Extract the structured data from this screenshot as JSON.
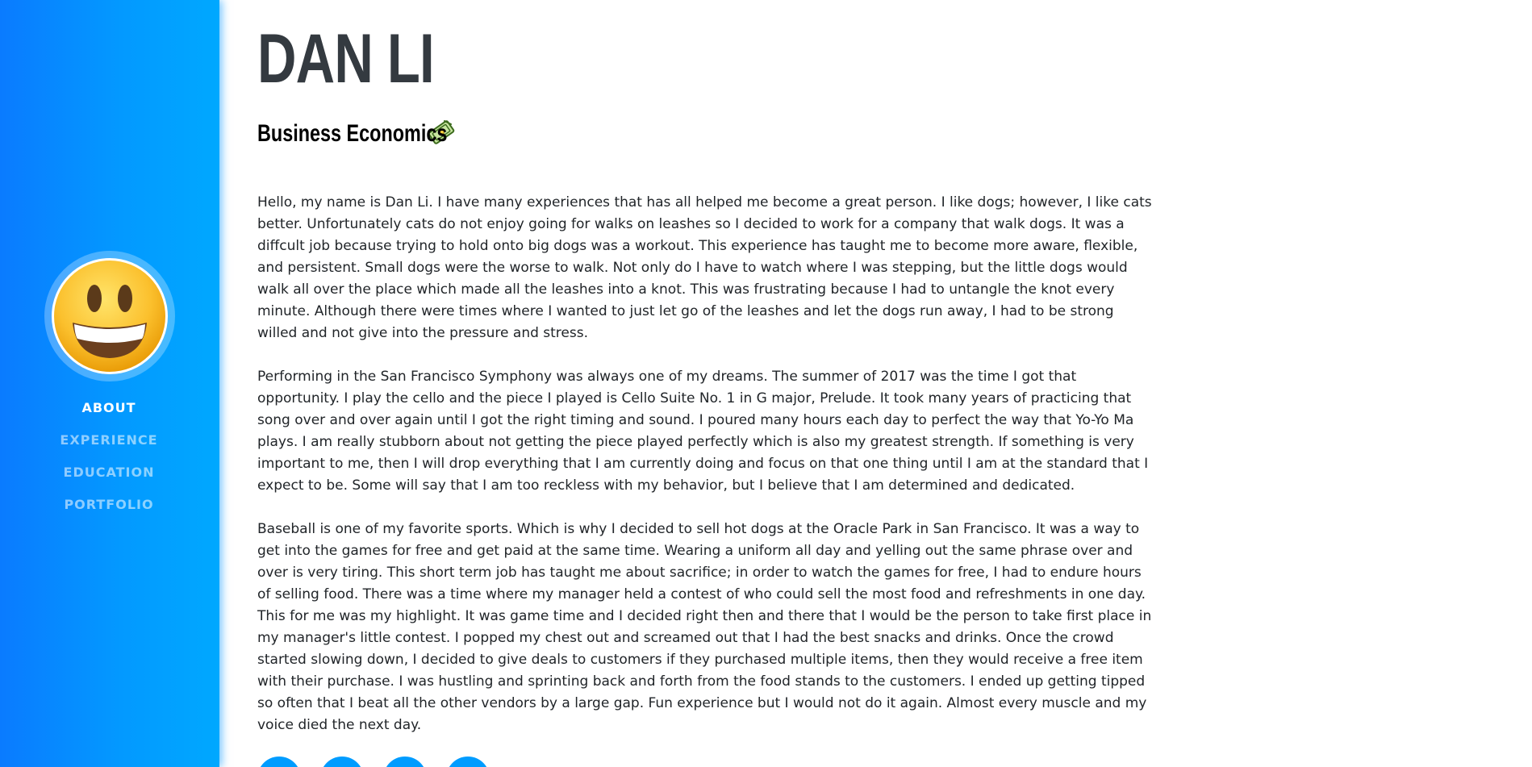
{
  "sidebar": {
    "avatar_icon": "smiling-face-emoji-icon",
    "nav": [
      {
        "label": "ABOUT",
        "active": true
      },
      {
        "label": "EXPERIENCE",
        "active": false
      },
      {
        "label": "EDUCATION",
        "active": false
      },
      {
        "label": "PORTFOLIO",
        "active": false
      }
    ]
  },
  "header": {
    "name": "DAN LI",
    "subtitle": "Business Economics",
    "subtitle_icon": "money-bag-icon"
  },
  "about": {
    "paragraphs": [
      "Hello, my name is Dan Li. I have many experiences that has all helped me become a great person. I like dogs; however, I like cats better. Unfortunately cats do not enjoy going for walks on leashes so I decided to work for a company that walk dogs. It was a diffcult job because trying to hold onto big dogs was a workout. This experience has taught me to become more aware, flexible, and persistent. Small dogs were the worse to walk. Not only do I have to watch where I was stepping, but the little dogs would walk all over the place which made all the leashes into a knot. This was frustrating because I had to untangle the knot every minute. Although there were times where I wanted to just let go of the leashes and let the dogs run away, I had to be strong willed and not give into the pressure and stress.",
      "Performing in the San Francisco Symphony was always one of my dreams. The summer of 2017 was the time I got that opportunity. I play the cello and the piece I played is Cello Suite No. 1 in G major, Prelude. It took many years of practicing that song over and over again until I got the right timing and sound. I poured many hours each day to perfect the way that Yo-Yo Ma plays. I am really stubborn about not getting the piece played perfectly which is also my greatest strength. If something is very important to me, then I will drop everything that I am currently doing and focus on that one thing until I am at the standard that I expect to be. Some will say that I am too reckless with my behavior, but I believe that I am determined and dedicated.",
      "Baseball is one of my favorite sports. Which is why I decided to sell hot dogs at the Oracle Park in San Francisco. It was a way to get into the games for free and get paid at the same time. Wearing a uniform all day and yelling out the same phrase over and over is very tiring. This short term job has taught me about sacrifice; in order to watch the games for free, I had to endure hours of selling food. There was a time where my manager held a contest of who could sell the most food and refreshments in one day. This for me was my highlight. It was game time and I decided right then and there that I would be the person to take first place in my manager's little contest. I popped my chest out and screamed out that I had the best snacks and drinks. Once the crowd started slowing down, I decided to give deals to customers if they purchased multiple items, then they would receive a free item with their purchase. I was hustling and sprinting back and forth from the food stands to the customers. I ended up getting tipped so often that I beat all the other vendors by a large gap. Fun experience but I would not do it again. Almost every muscle and my voice died the next day."
    ]
  },
  "social": [
    "social-icon-1",
    "social-icon-2",
    "social-icon-3",
    "social-icon-4"
  ],
  "colors": {
    "sidebar_start": "#0a7bff",
    "sidebar_end": "#00a8ff",
    "heading": "#343a40",
    "body_text": "#212529",
    "social_button": "#009cff"
  }
}
